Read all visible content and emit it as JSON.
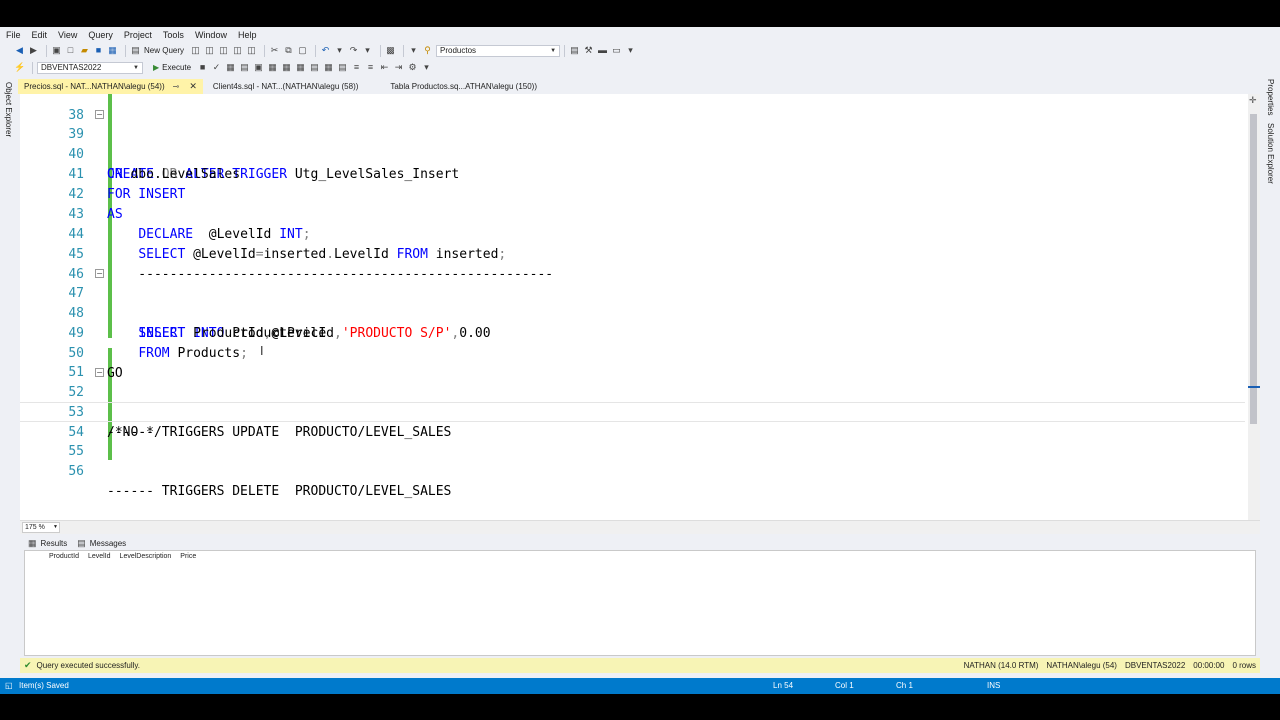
{
  "menu": [
    "File",
    "Edit",
    "View",
    "Query",
    "Project",
    "Tools",
    "Window",
    "Help"
  ],
  "toolbar": {
    "new_query": "New Query",
    "solution_combo": "Productos",
    "database_combo": "DBVENTAS2022",
    "execute": "Execute"
  },
  "side": {
    "left_panel": "Object Explorer",
    "right_properties": "Properties",
    "right_solution": "Solution Explorer"
  },
  "tabs": [
    {
      "label": "Precios.sql - NAT...NATHAN\\alegu (54))",
      "active": true
    },
    {
      "label": "Client4s.sql - NAT...(NATHAN\\alegu (58))",
      "active": false
    },
    {
      "label": "Tabla Productos.sq...ATHAN\\alegu (150))",
      "active": false
    }
  ],
  "editor": {
    "top_partial_line": "38",
    "lines": [
      {
        "n": "39",
        "fold": "minus",
        "text": "CREATE OR ALTER TRIGGER Utg_LevelSales_Insert"
      },
      {
        "n": "40",
        "text": "ON dbo.LevelSales"
      },
      {
        "n": "41",
        "text": "FOR INSERT"
      },
      {
        "n": "42",
        "text": "AS"
      },
      {
        "n": "43",
        "text": "    DECLARE  @LevelId INT;"
      },
      {
        "n": "44",
        "text": "    SELECT @LevelId=inserted.LevelId FROM inserted;"
      },
      {
        "n": "45",
        "text": "    -----------------------------------------------------"
      },
      {
        "n": "46",
        "text": ""
      },
      {
        "n": "47",
        "fold": "minus",
        "text": "    INSERT INTO ProductPrice"
      },
      {
        "n": "48",
        "text": "    SELECT ProductId,@LevelId,'PRODUCTO S/P',0.00"
      },
      {
        "n": "49",
        "text": "    FROM Products;"
      },
      {
        "n": "50",
        "text": "GO"
      },
      {
        "n": "51",
        "text": ""
      },
      {
        "n": "52",
        "fold": "minus",
        "text": "------ TRIGGERS UPDATE  PRODUCTO/LEVEL_SALES"
      },
      {
        "n": "53",
        "text": "/*NO-*/"
      },
      {
        "n": "54",
        "text": ""
      },
      {
        "n": "55",
        "text": ""
      },
      {
        "n": "56",
        "text": "------ TRIGGERS DELETE  PRODUCTO/LEVEL_SALES"
      }
    ]
  },
  "zoom": "175 %",
  "results": {
    "tabs": [
      "Results",
      "Messages"
    ],
    "columns": [
      "ProductId",
      "LevelId",
      "LevelDescription",
      "Price"
    ]
  },
  "status": {
    "message": "Query executed successfully.",
    "server": "NATHAN (14.0 RTM)",
    "user": "NATHAN\\alegu (54)",
    "database": "DBVENTAS2022",
    "time": "00:00:00",
    "rows": "0 rows"
  },
  "statusbar": {
    "left": "Item(s) Saved",
    "ln": "Ln 54",
    "col": "Col 1",
    "ch": "Ch 1",
    "mode": "INS"
  },
  "colors": {
    "keyword": "#0000ff",
    "string": "#ff0000",
    "comment": "#008000",
    "line_number": "#2b91af",
    "statusbar": "#007acc",
    "active_tab": "#fff3a8"
  }
}
